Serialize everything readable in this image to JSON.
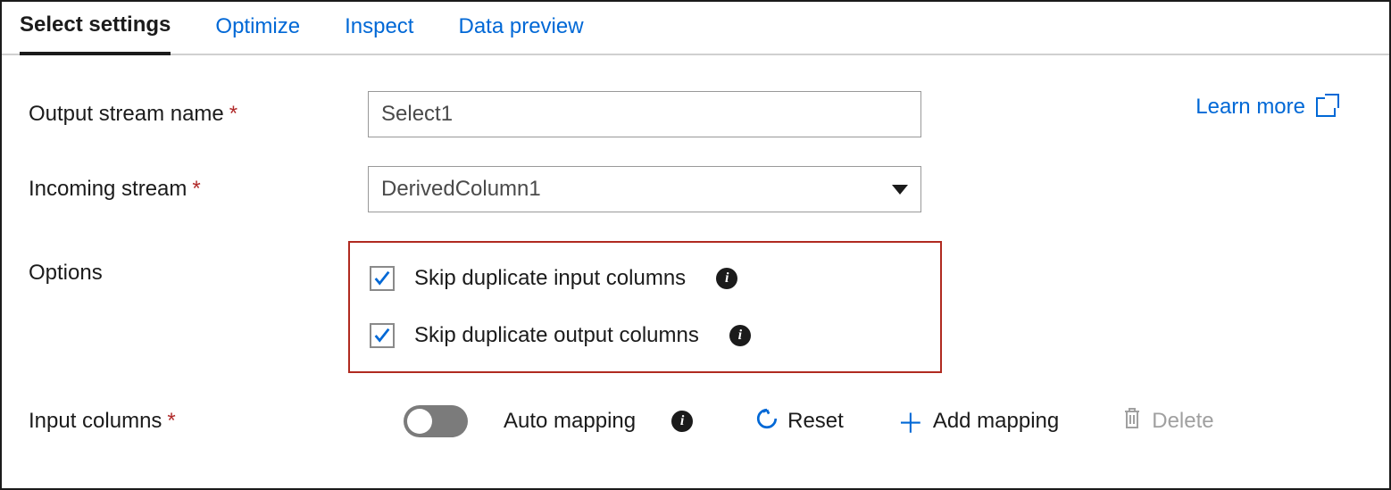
{
  "tabs": [
    {
      "label": "Select settings",
      "active": true
    },
    {
      "label": "Optimize",
      "active": false
    },
    {
      "label": "Inspect",
      "active": false
    },
    {
      "label": "Data preview",
      "active": false
    }
  ],
  "learn_more": "Learn more",
  "fields": {
    "output_stream": {
      "label": "Output stream name",
      "required": true,
      "value": "Select1"
    },
    "incoming_stream": {
      "label": "Incoming stream",
      "required": true,
      "value": "DerivedColumn1"
    },
    "options_label": "Options",
    "options": {
      "skip_dup_in": {
        "label": "Skip duplicate input columns",
        "checked": true
      },
      "skip_dup_out": {
        "label": "Skip duplicate output columns",
        "checked": true
      }
    },
    "input_columns": {
      "label": "Input columns",
      "required": true
    }
  },
  "toolbar": {
    "auto_mapping": "Auto mapping",
    "reset": "Reset",
    "add_mapping": "Add mapping",
    "delete": "Delete"
  }
}
